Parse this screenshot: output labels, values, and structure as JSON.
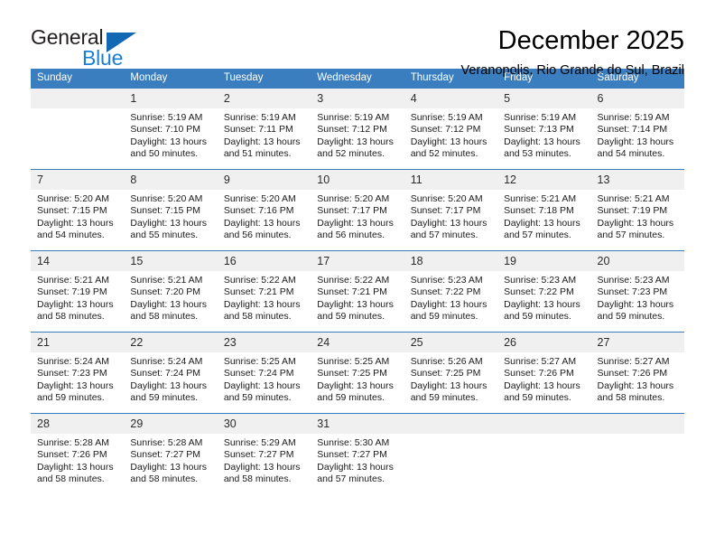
{
  "brand": {
    "name_part1": "General",
    "name_part2": "Blue",
    "accent_color": "#1a7fd4",
    "triangle_color": "#1268b3"
  },
  "header": {
    "title": "December 2025",
    "subtitle": "Veranopolis, Rio Grande do Sul, Brazil"
  },
  "calendar": {
    "header_color": "#3a7ebf",
    "weekdays": [
      "Sunday",
      "Monday",
      "Tuesday",
      "Wednesday",
      "Thursday",
      "Friday",
      "Saturday"
    ],
    "weeks": [
      [
        {
          "day": "",
          "sunrise": "",
          "sunset": "",
          "daylight_line1": "",
          "daylight_line2": "",
          "empty": true
        },
        {
          "day": "1",
          "sunrise": "Sunrise: 5:19 AM",
          "sunset": "Sunset: 7:10 PM",
          "daylight_line1": "Daylight: 13 hours",
          "daylight_line2": "and 50 minutes."
        },
        {
          "day": "2",
          "sunrise": "Sunrise: 5:19 AM",
          "sunset": "Sunset: 7:11 PM",
          "daylight_line1": "Daylight: 13 hours",
          "daylight_line2": "and 51 minutes."
        },
        {
          "day": "3",
          "sunrise": "Sunrise: 5:19 AM",
          "sunset": "Sunset: 7:12 PM",
          "daylight_line1": "Daylight: 13 hours",
          "daylight_line2": "and 52 minutes."
        },
        {
          "day": "4",
          "sunrise": "Sunrise: 5:19 AM",
          "sunset": "Sunset: 7:12 PM",
          "daylight_line1": "Daylight: 13 hours",
          "daylight_line2": "and 52 minutes."
        },
        {
          "day": "5",
          "sunrise": "Sunrise: 5:19 AM",
          "sunset": "Sunset: 7:13 PM",
          "daylight_line1": "Daylight: 13 hours",
          "daylight_line2": "and 53 minutes."
        },
        {
          "day": "6",
          "sunrise": "Sunrise: 5:19 AM",
          "sunset": "Sunset: 7:14 PM",
          "daylight_line1": "Daylight: 13 hours",
          "daylight_line2": "and 54 minutes."
        }
      ],
      [
        {
          "day": "7",
          "sunrise": "Sunrise: 5:20 AM",
          "sunset": "Sunset: 7:15 PM",
          "daylight_line1": "Daylight: 13 hours",
          "daylight_line2": "and 54 minutes."
        },
        {
          "day": "8",
          "sunrise": "Sunrise: 5:20 AM",
          "sunset": "Sunset: 7:15 PM",
          "daylight_line1": "Daylight: 13 hours",
          "daylight_line2": "and 55 minutes."
        },
        {
          "day": "9",
          "sunrise": "Sunrise: 5:20 AM",
          "sunset": "Sunset: 7:16 PM",
          "daylight_line1": "Daylight: 13 hours",
          "daylight_line2": "and 56 minutes."
        },
        {
          "day": "10",
          "sunrise": "Sunrise: 5:20 AM",
          "sunset": "Sunset: 7:17 PM",
          "daylight_line1": "Daylight: 13 hours",
          "daylight_line2": "and 56 minutes."
        },
        {
          "day": "11",
          "sunrise": "Sunrise: 5:20 AM",
          "sunset": "Sunset: 7:17 PM",
          "daylight_line1": "Daylight: 13 hours",
          "daylight_line2": "and 57 minutes."
        },
        {
          "day": "12",
          "sunrise": "Sunrise: 5:21 AM",
          "sunset": "Sunset: 7:18 PM",
          "daylight_line1": "Daylight: 13 hours",
          "daylight_line2": "and 57 minutes."
        },
        {
          "day": "13",
          "sunrise": "Sunrise: 5:21 AM",
          "sunset": "Sunset: 7:19 PM",
          "daylight_line1": "Daylight: 13 hours",
          "daylight_line2": "and 57 minutes."
        }
      ],
      [
        {
          "day": "14",
          "sunrise": "Sunrise: 5:21 AM",
          "sunset": "Sunset: 7:19 PM",
          "daylight_line1": "Daylight: 13 hours",
          "daylight_line2": "and 58 minutes."
        },
        {
          "day": "15",
          "sunrise": "Sunrise: 5:21 AM",
          "sunset": "Sunset: 7:20 PM",
          "daylight_line1": "Daylight: 13 hours",
          "daylight_line2": "and 58 minutes."
        },
        {
          "day": "16",
          "sunrise": "Sunrise: 5:22 AM",
          "sunset": "Sunset: 7:21 PM",
          "daylight_line1": "Daylight: 13 hours",
          "daylight_line2": "and 58 minutes."
        },
        {
          "day": "17",
          "sunrise": "Sunrise: 5:22 AM",
          "sunset": "Sunset: 7:21 PM",
          "daylight_line1": "Daylight: 13 hours",
          "daylight_line2": "and 59 minutes."
        },
        {
          "day": "18",
          "sunrise": "Sunrise: 5:23 AM",
          "sunset": "Sunset: 7:22 PM",
          "daylight_line1": "Daylight: 13 hours",
          "daylight_line2": "and 59 minutes."
        },
        {
          "day": "19",
          "sunrise": "Sunrise: 5:23 AM",
          "sunset": "Sunset: 7:22 PM",
          "daylight_line1": "Daylight: 13 hours",
          "daylight_line2": "and 59 minutes."
        },
        {
          "day": "20",
          "sunrise": "Sunrise: 5:23 AM",
          "sunset": "Sunset: 7:23 PM",
          "daylight_line1": "Daylight: 13 hours",
          "daylight_line2": "and 59 minutes."
        }
      ],
      [
        {
          "day": "21",
          "sunrise": "Sunrise: 5:24 AM",
          "sunset": "Sunset: 7:23 PM",
          "daylight_line1": "Daylight: 13 hours",
          "daylight_line2": "and 59 minutes."
        },
        {
          "day": "22",
          "sunrise": "Sunrise: 5:24 AM",
          "sunset": "Sunset: 7:24 PM",
          "daylight_line1": "Daylight: 13 hours",
          "daylight_line2": "and 59 minutes."
        },
        {
          "day": "23",
          "sunrise": "Sunrise: 5:25 AM",
          "sunset": "Sunset: 7:24 PM",
          "daylight_line1": "Daylight: 13 hours",
          "daylight_line2": "and 59 minutes."
        },
        {
          "day": "24",
          "sunrise": "Sunrise: 5:25 AM",
          "sunset": "Sunset: 7:25 PM",
          "daylight_line1": "Daylight: 13 hours",
          "daylight_line2": "and 59 minutes."
        },
        {
          "day": "25",
          "sunrise": "Sunrise: 5:26 AM",
          "sunset": "Sunset: 7:25 PM",
          "daylight_line1": "Daylight: 13 hours",
          "daylight_line2": "and 59 minutes."
        },
        {
          "day": "26",
          "sunrise": "Sunrise: 5:27 AM",
          "sunset": "Sunset: 7:26 PM",
          "daylight_line1": "Daylight: 13 hours",
          "daylight_line2": "and 59 minutes."
        },
        {
          "day": "27",
          "sunrise": "Sunrise: 5:27 AM",
          "sunset": "Sunset: 7:26 PM",
          "daylight_line1": "Daylight: 13 hours",
          "daylight_line2": "and 58 minutes."
        }
      ],
      [
        {
          "day": "28",
          "sunrise": "Sunrise: 5:28 AM",
          "sunset": "Sunset: 7:26 PM",
          "daylight_line1": "Daylight: 13 hours",
          "daylight_line2": "and 58 minutes."
        },
        {
          "day": "29",
          "sunrise": "Sunrise: 5:28 AM",
          "sunset": "Sunset: 7:27 PM",
          "daylight_line1": "Daylight: 13 hours",
          "daylight_line2": "and 58 minutes."
        },
        {
          "day": "30",
          "sunrise": "Sunrise: 5:29 AM",
          "sunset": "Sunset: 7:27 PM",
          "daylight_line1": "Daylight: 13 hours",
          "daylight_line2": "and 58 minutes."
        },
        {
          "day": "31",
          "sunrise": "Sunrise: 5:30 AM",
          "sunset": "Sunset: 7:27 PM",
          "daylight_line1": "Daylight: 13 hours",
          "daylight_line2": "and 57 minutes."
        },
        {
          "day": "",
          "sunrise": "",
          "sunset": "",
          "daylight_line1": "",
          "daylight_line2": "",
          "empty": true
        },
        {
          "day": "",
          "sunrise": "",
          "sunset": "",
          "daylight_line1": "",
          "daylight_line2": "",
          "empty": true
        },
        {
          "day": "",
          "sunrise": "",
          "sunset": "",
          "daylight_line1": "",
          "daylight_line2": "",
          "empty": true
        }
      ]
    ]
  }
}
